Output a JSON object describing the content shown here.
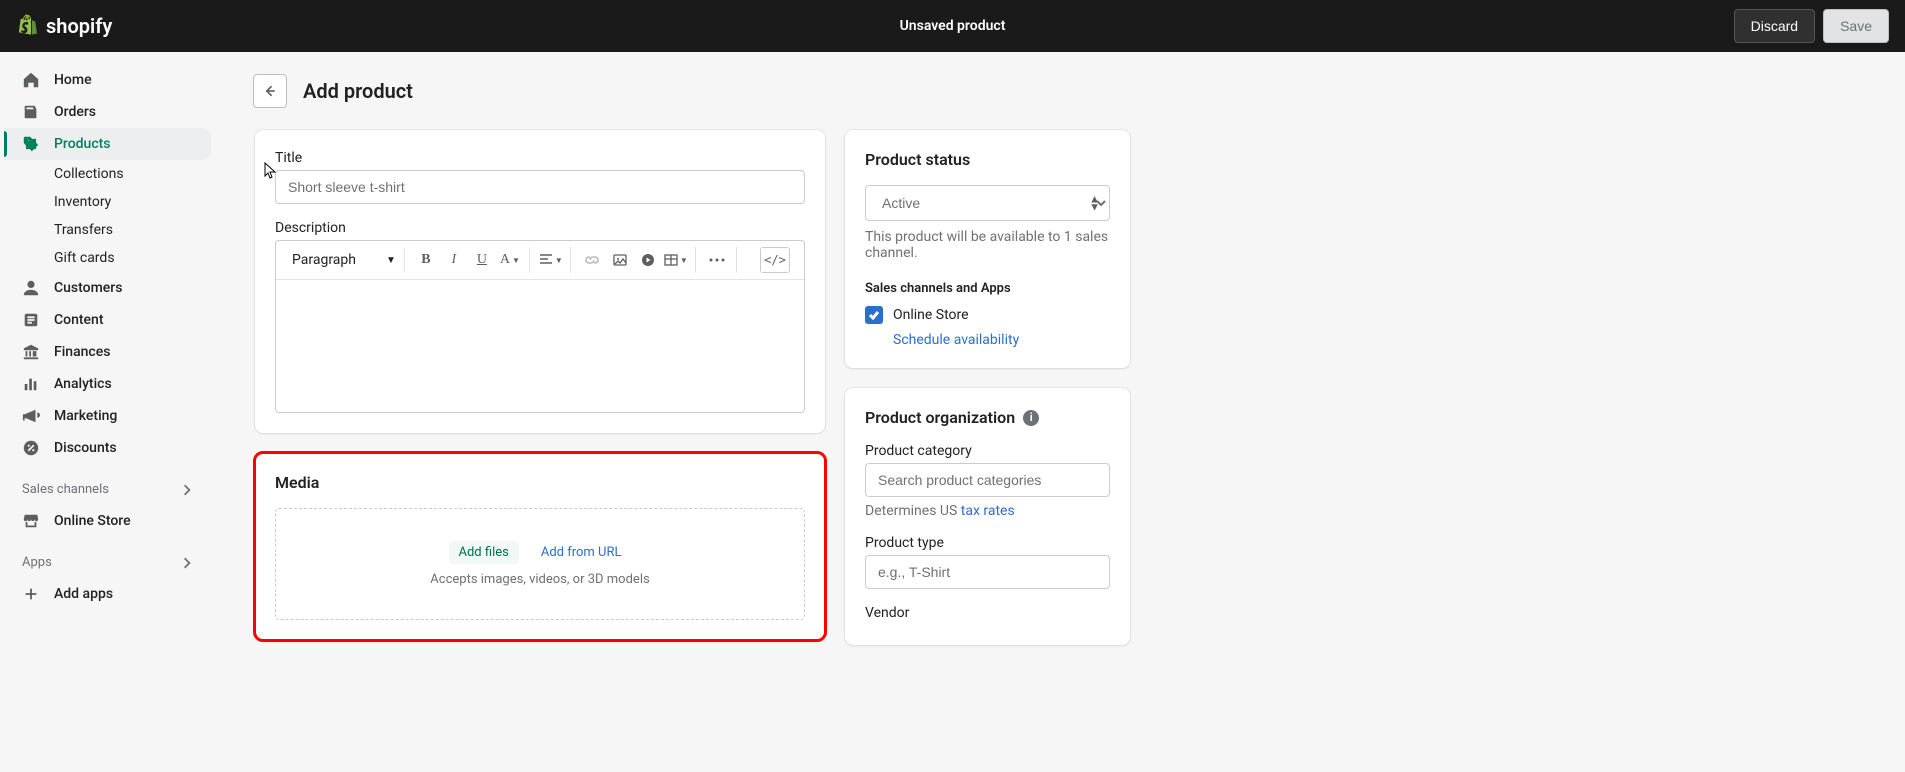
{
  "header": {
    "brand": "shopify",
    "unsaved": "Unsaved product",
    "discard": "Discard",
    "save": "Save"
  },
  "sidebar": {
    "items": [
      {
        "label": "Home"
      },
      {
        "label": "Orders"
      },
      {
        "label": "Products"
      },
      {
        "label": "Customers"
      },
      {
        "label": "Content"
      },
      {
        "label": "Finances"
      },
      {
        "label": "Analytics"
      },
      {
        "label": "Marketing"
      },
      {
        "label": "Discounts"
      }
    ],
    "subs": {
      "collections": "Collections",
      "inventory": "Inventory",
      "transfers": "Transfers",
      "gift_cards": "Gift cards"
    },
    "sales_channels": "Sales channels",
    "online_store": "Online Store",
    "apps": "Apps",
    "add_apps": "Add apps"
  },
  "page": {
    "title": "Add product"
  },
  "title_card": {
    "label": "Title",
    "placeholder": "Short sleeve t-shirt",
    "desc_label": "Description",
    "paragraph": "Paragraph"
  },
  "media": {
    "title": "Media",
    "add_files": "Add files",
    "add_url": "Add from URL",
    "hint": "Accepts images, videos, or 3D models"
  },
  "status": {
    "title": "Product status",
    "value": "Active",
    "hint1": "This product will be available to 1 sales channel.",
    "sub": "Sales channels and Apps",
    "online": "Online Store",
    "schedule": "Schedule availability"
  },
  "org": {
    "title": "Product organization",
    "cat_label": "Product category",
    "cat_placeholder": "Search product categories",
    "cat_hint_prefix": "Determines US ",
    "cat_hint_link": "tax rates",
    "type_label": "Product type",
    "type_placeholder": "e.g., T-Shirt",
    "vendor_label": "Vendor"
  }
}
